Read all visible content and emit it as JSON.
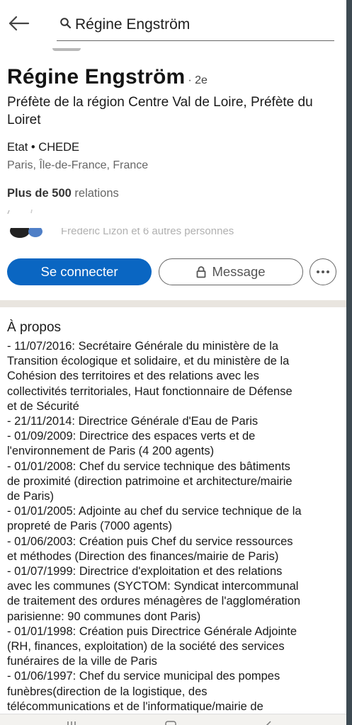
{
  "search": {
    "query": "Régine Engström"
  },
  "profile": {
    "name": "Régine Engström",
    "degree": "· 2e",
    "headline": "Préfète de la région Centre Val de Loire, Préfète du Loiret",
    "company": "Etat • CHEDE",
    "location": "Paris, Île-de-France, France",
    "connections_count": "Plus de 500",
    "connections_label": " relations",
    "mutual_text": "Frédéric Lizon et 6 autres personnes"
  },
  "actions": {
    "connect_label": "Se connecter",
    "message_label": "Message"
  },
  "about": {
    "title": "À propos",
    "lines": [
      "- 11/07/2016: Secrétaire Générale du ministère de la",
      "Transition écologique et solidaire, et du ministère de la",
      "Cohésion des territoires et des relations avec les",
      "collectivités territoriales, Haut fonctionnaire de Défense",
      "et de Sécurité",
      "- 21/11/2014: Directrice Générale d'Eau de Paris",
      "- 01/09/2009: Directrice des espaces verts et de",
      "l'environnement de Paris (4 200 agents)",
      "- 01/01/2008: Chef du service technique des bâtiments",
      "de proximité (direction patrimoine et architecture/mairie",
      "de Paris)",
      "- 01/01/2005: Adjointe au chef du service technique de la",
      "propreté de Paris (7000 agents)",
      "- 01/06/2003: Création puis Chef du service ressources",
      "et méthodes (Direction des finances/mairie de Paris)",
      "- 01/07/1999: Directrice d'exploitation et des relations",
      "avec les communes (SYCTOM: Syndicat intercommunal",
      "de traitement des ordures ménagères de l'agglomération",
      "parisienne: 90 communes dont Paris)",
      "- 01/01/1998: Création puis Directrice Générale Adjointe",
      "(RH, finances, exploitation) de la société des services",
      "funéraires de la ville de Paris",
      "- 01/06/1997: Chef du service municipal des pompes",
      "funèbres(direction de la logistique, des",
      "télécommunications et de l'informatique/mairie de"
    ]
  },
  "colors": {
    "accent": "#0a66c2",
    "divider": "#e9e5df",
    "muted_text": "#666666"
  },
  "icons": {
    "back": "arrow-left-icon",
    "search": "search-icon",
    "lock": "lock-icon",
    "more": "more-horizontal-icon"
  }
}
